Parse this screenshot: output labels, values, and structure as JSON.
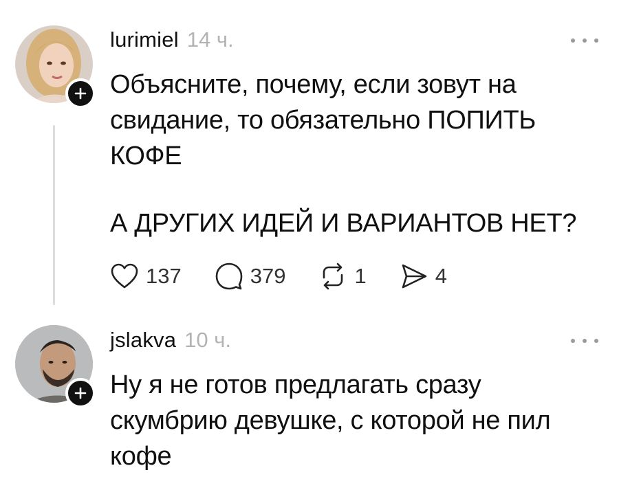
{
  "posts": [
    {
      "username": "lurimiel",
      "time": "14 ч.",
      "paragraphs": [
        "Объясните, почему, если зовут на свидание, то обязательно ПОПИТЬ КОФЕ",
        "А ДРУГИХ ИДЕЙ И ВАРИАНТОВ НЕТ?"
      ],
      "likes": "137",
      "comments": "379",
      "reposts": "1",
      "shares": "4"
    },
    {
      "username": "jslakva",
      "time": "10 ч.",
      "paragraphs": [
        "Ну я не готов предлагать сразу скумбрию девушке, с которой не пил кофе"
      ]
    }
  ],
  "icons": {
    "like": "heart-icon",
    "comment": "comment-bubble-icon",
    "repost": "repost-icon",
    "share": "send-icon",
    "more": "more-dots-icon",
    "follow": "plus-icon"
  },
  "colors": {
    "text": "#101010",
    "muted": "#b3b3b3",
    "thread_line": "#dcdcdc",
    "follow_badge": "#111111"
  }
}
